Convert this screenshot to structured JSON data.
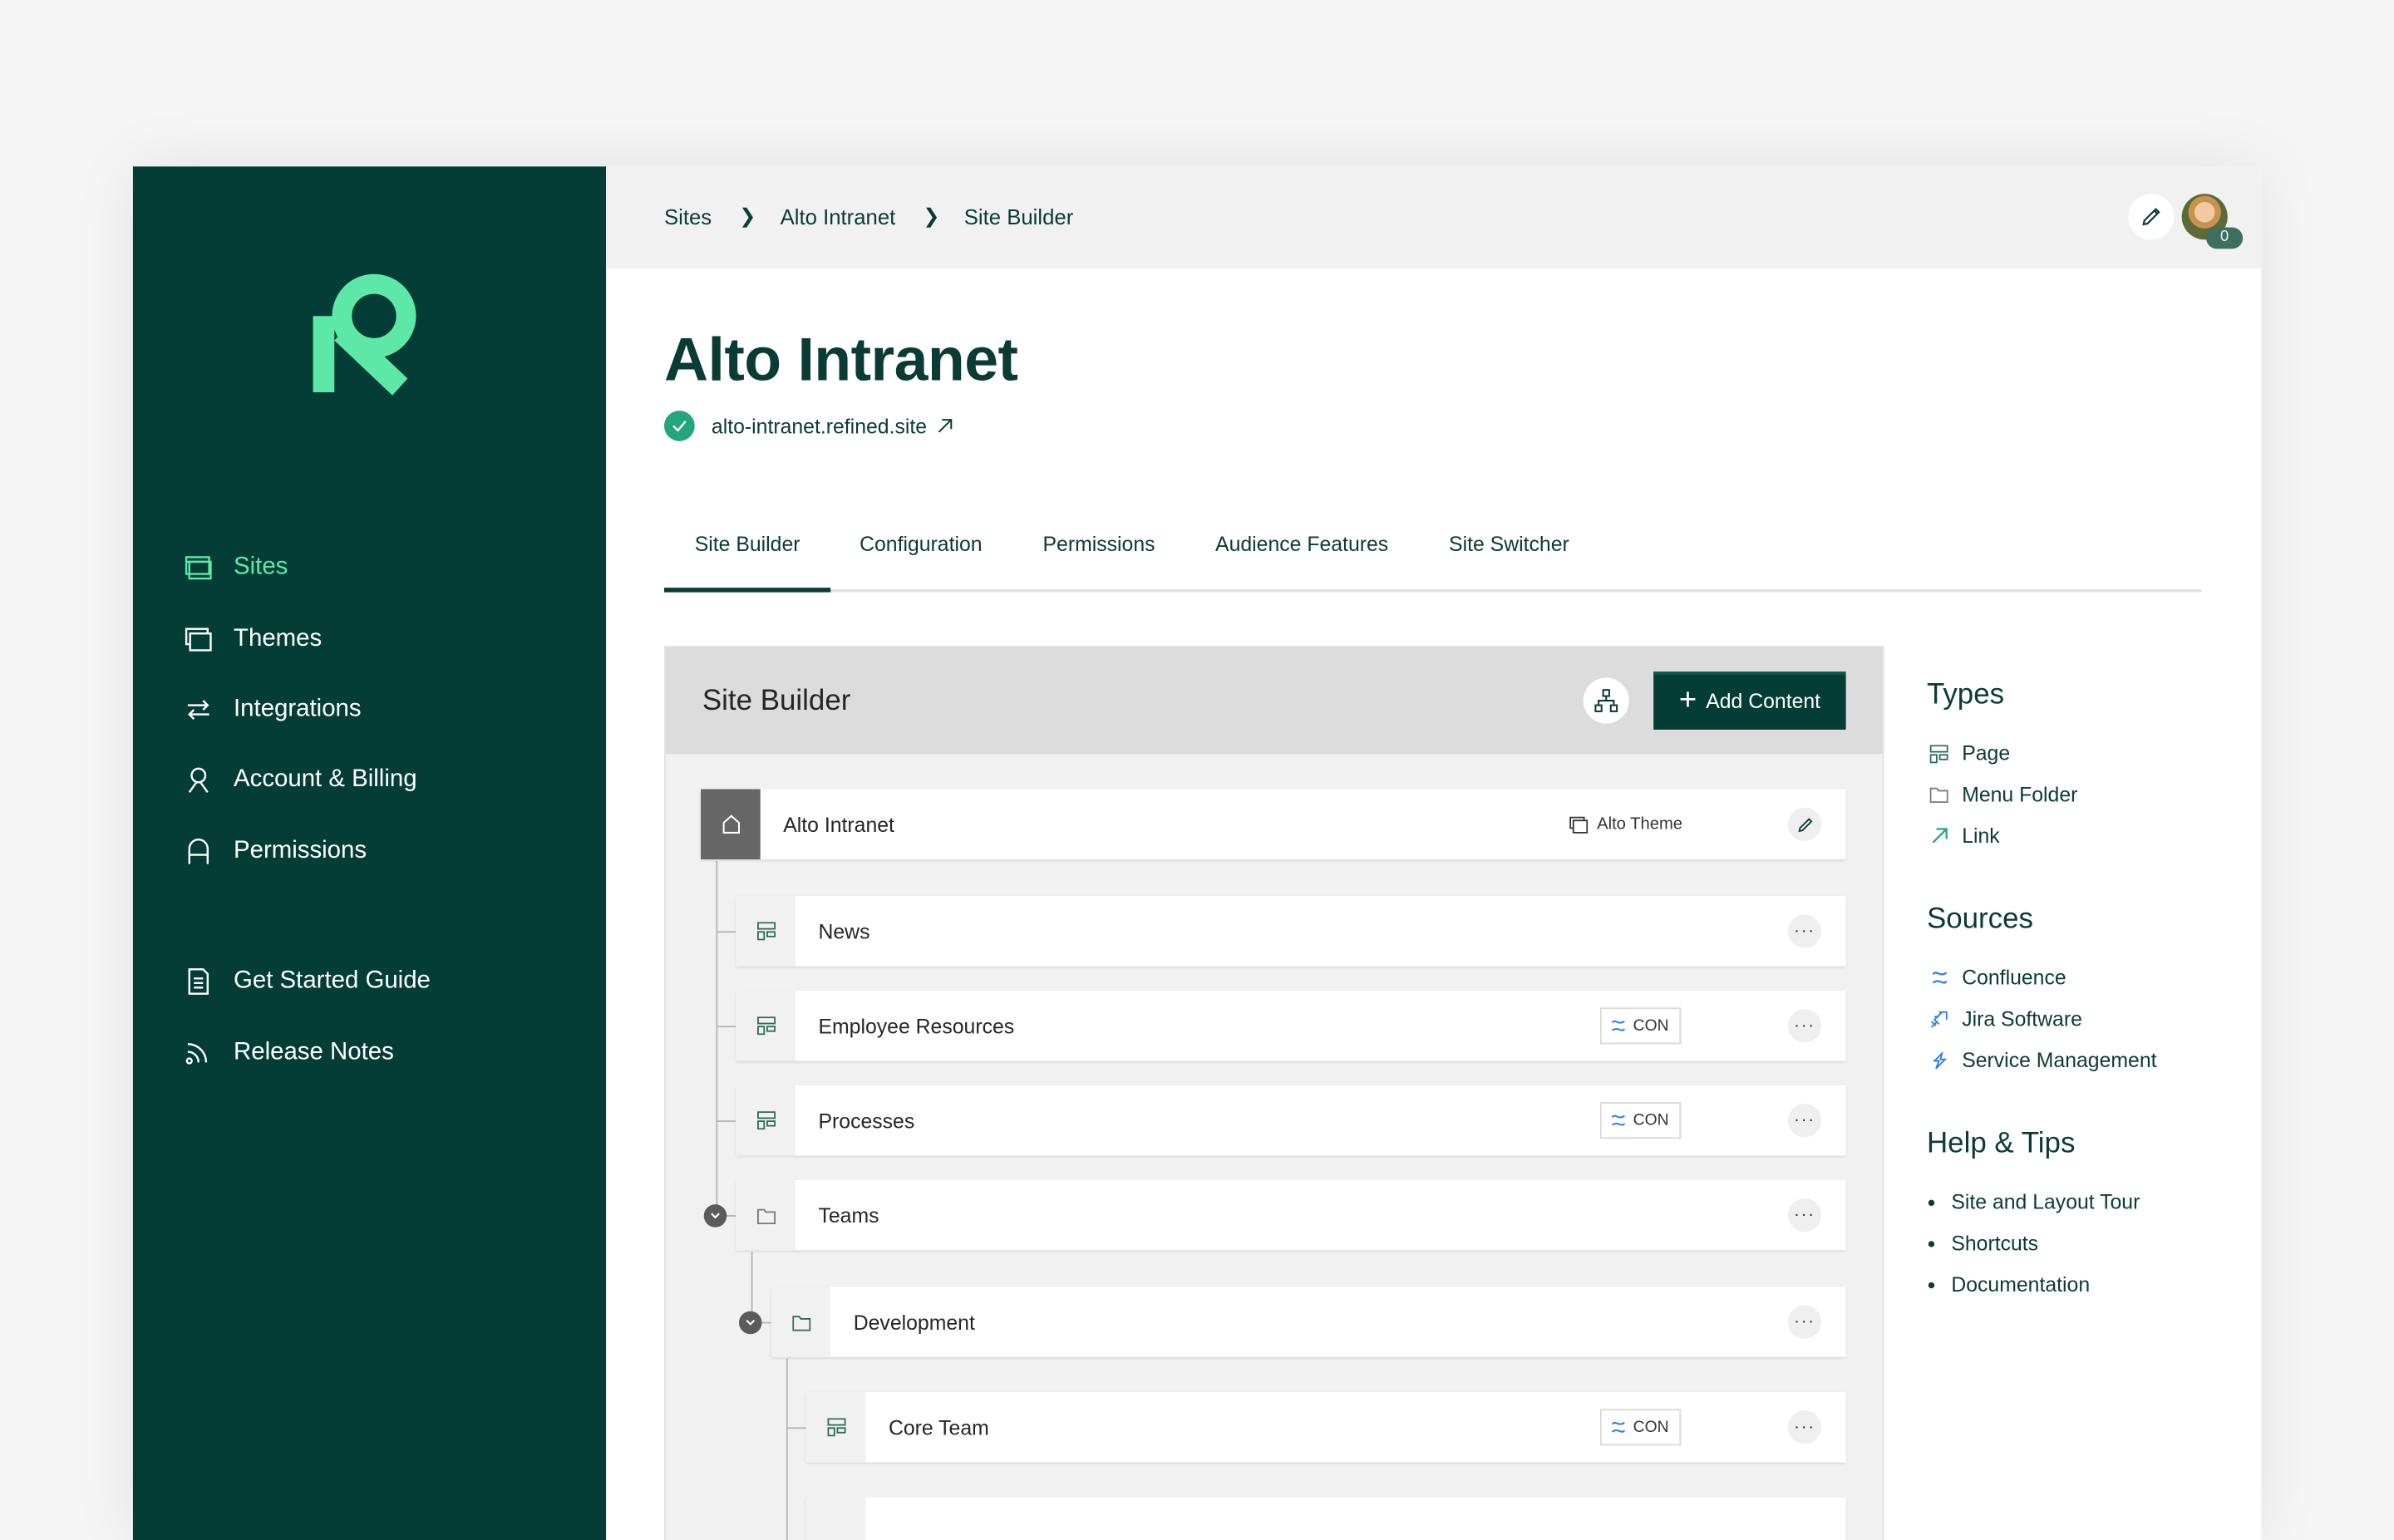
{
  "sidebar": {
    "logo": "refined-logo",
    "items": [
      {
        "label": "Sites",
        "icon": "sites-icon",
        "active": true
      },
      {
        "label": "Themes",
        "icon": "themes-icon"
      },
      {
        "label": "Integrations",
        "icon": "integrations-icon"
      },
      {
        "label": "Account & Billing",
        "icon": "account-icon"
      },
      {
        "label": "Permissions",
        "icon": "permissions-icon"
      }
    ],
    "secondary": [
      {
        "label": "Get Started Guide",
        "icon": "document-icon"
      },
      {
        "label": "Release Notes",
        "icon": "rss-icon"
      }
    ]
  },
  "breadcrumb": [
    "Sites",
    "Alto Intranet",
    "Site Builder"
  ],
  "user": {
    "notification_count": "0"
  },
  "page": {
    "title": "Alto Intranet",
    "url": "alto-intranet.refined.site",
    "status": "verified"
  },
  "tabs": [
    "Site Builder",
    "Configuration",
    "Permissions",
    "Audience Features",
    "Site Switcher"
  ],
  "active_tab": "Site Builder",
  "builder": {
    "title": "Site Builder",
    "add_label": "Add Content",
    "root": {
      "label": "Alto Intranet",
      "theme": "Alto Theme"
    },
    "rows": [
      {
        "label": "News",
        "type": "page"
      },
      {
        "label": "Employee Resources",
        "type": "page",
        "badge": "CON"
      },
      {
        "label": "Processes",
        "type": "page",
        "badge": "CON"
      },
      {
        "label": "Teams",
        "type": "folder",
        "expanded": true
      },
      {
        "label": "Development",
        "type": "folder",
        "expanded": true
      },
      {
        "label": "Core Team",
        "type": "page",
        "badge": "CON"
      }
    ]
  },
  "panel": {
    "types_title": "Types",
    "types": [
      "Page",
      "Menu Folder",
      "Link"
    ],
    "sources_title": "Sources",
    "sources": [
      "Confluence",
      "Jira Software",
      "Service Management"
    ],
    "help_title": "Help & Tips",
    "help": [
      "Site and Layout Tour",
      "Shortcuts",
      "Documentation"
    ]
  },
  "colors": {
    "brand_dark": "#043d36",
    "brand_accent": "#5ee8a7",
    "text": "#0b3b35",
    "success": "#25a57b",
    "confluence": "#2f7de1"
  }
}
